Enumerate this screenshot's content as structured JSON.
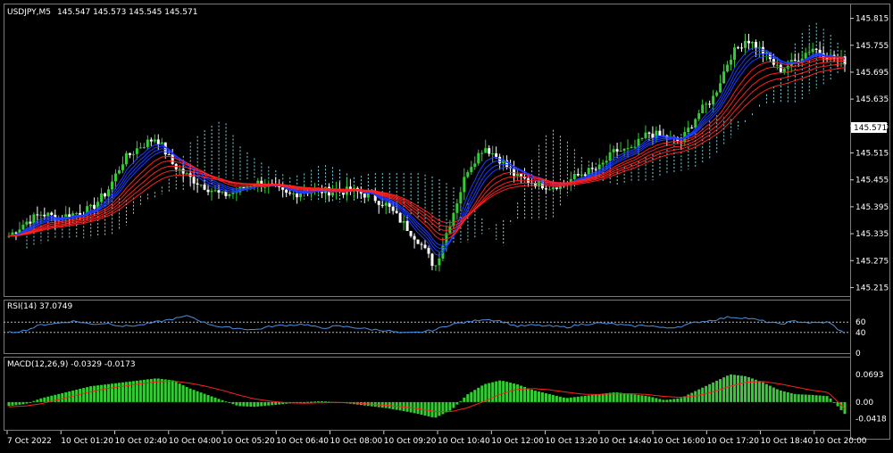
{
  "main": {
    "symbol": "USDJPY,M5",
    "ohlc": "145.547 145.573 145.545 145.571",
    "last_price": "145.571",
    "colors": {
      "bull": "#32cd32",
      "bear": "#ffffff",
      "fast_ma": "#1e3cff",
      "slow_ma": "#ff2020",
      "cloud": "#7fd3dc",
      "bg": "#000000",
      "grid": "#7a7a7a"
    }
  },
  "rsi": {
    "label": "RSI(14) 37.0749",
    "line_color": "#4a90e2",
    "levels": [
      60,
      40
    ]
  },
  "macd": {
    "label": "MACD(12,26,9) -0.0329 -0.0173",
    "hist_color": "#32cd32",
    "signal_color": "#ff2020"
  },
  "chart_data": [
    {
      "type": "line",
      "title": "USDJPY,M5",
      "ylim": [
        145.2,
        145.84
      ],
      "yticks": [
        "145.815",
        "145.755",
        "145.695",
        "145.635",
        "145.575",
        "145.515",
        "145.455",
        "145.395",
        "145.335",
        "145.275",
        "145.215"
      ],
      "xticks": [
        "7 Oct 2022",
        "10 Oct 01:20",
        "10 Oct 02:40",
        "10 Oct 04:00",
        "10 Oct 05:20",
        "10 Oct 06:40",
        "10 Oct 08:00",
        "10 Oct 09:20",
        "10 Oct 10:40",
        "10 Oct 12:00",
        "10 Oct 13:20",
        "10 Oct 14:40",
        "10 Oct 16:00",
        "10 Oct 17:20",
        "10 Oct 18:40",
        "10 Oct 20:00"
      ],
      "series": [
        {
          "values": [
            145.33,
            145.36,
            145.38,
            145.37,
            145.38,
            145.39,
            145.43,
            145.5,
            145.53,
            145.55,
            145.49,
            145.46,
            145.44,
            145.42,
            145.43,
            145.45,
            145.44,
            145.42,
            145.43,
            145.43,
            145.43,
            145.43,
            145.42,
            145.4,
            145.36,
            145.32,
            145.26,
            145.37,
            145.48,
            145.53,
            145.5,
            145.46,
            145.45,
            145.44,
            145.45,
            145.47,
            145.48,
            145.52,
            145.52,
            145.56,
            145.55,
            145.54,
            145.6,
            145.64,
            145.73,
            145.77,
            145.74,
            145.7,
            145.72,
            145.75,
            145.73,
            145.72
          ]
        }
      ]
    },
    {
      "type": "line",
      "title": "RSI(14) 37.0749",
      "ylim": [
        0,
        100
      ],
      "yticks": [
        "60",
        "40",
        "0"
      ],
      "series": [
        {
          "values": [
            40,
            44,
            55,
            58,
            62,
            56,
            58,
            52,
            54,
            60,
            66,
            72,
            58,
            50,
            48,
            45,
            52,
            54,
            56,
            48,
            52,
            50,
            46,
            44,
            38,
            40,
            45,
            56,
            60,
            66,
            62,
            52,
            54,
            52,
            50,
            56,
            58,
            56,
            52,
            54,
            48,
            52,
            60,
            64,
            70,
            68,
            62,
            56,
            62,
            58,
            60,
            37
          ]
        }
      ]
    },
    {
      "type": "bar",
      "title": "MACD(12,26,9) -0.0329 -0.0173",
      "ylim": [
        -0.07,
        0.11
      ],
      "yticks": [
        "0.0693",
        "0.00",
        "-0.0418"
      ],
      "series": [
        {
          "values": [
            -0.01,
            -0.005,
            0.01,
            0.02,
            0.03,
            0.04,
            0.045,
            0.05,
            0.055,
            0.06,
            0.055,
            0.035,
            0.02,
            0.005,
            -0.01,
            -0.012,
            -0.008,
            -0.004,
            0.0,
            0.002,
            0.0,
            -0.005,
            -0.01,
            -0.015,
            -0.022,
            -0.03,
            -0.04,
            -0.02,
            0.02,
            0.045,
            0.055,
            0.045,
            0.03,
            0.02,
            0.01,
            0.015,
            0.02,
            0.025,
            0.02,
            0.015,
            0.005,
            0.01,
            0.03,
            0.05,
            0.07,
            0.065,
            0.05,
            0.03,
            0.02,
            0.018,
            0.015,
            -0.03
          ]
        },
        {
          "values": [
            -0.012,
            -0.01,
            -0.004,
            0.006,
            0.016,
            0.026,
            0.034,
            0.04,
            0.046,
            0.051,
            0.053,
            0.048,
            0.04,
            0.03,
            0.018,
            0.008,
            0.002,
            -0.002,
            -0.003,
            -0.002,
            -0.001,
            -0.002,
            -0.005,
            -0.008,
            -0.012,
            -0.017,
            -0.024,
            -0.024,
            -0.014,
            0.002,
            0.02,
            0.032,
            0.034,
            0.031,
            0.025,
            0.02,
            0.019,
            0.021,
            0.021,
            0.019,
            0.014,
            0.012,
            0.016,
            0.026,
            0.04,
            0.05,
            0.052,
            0.046,
            0.038,
            0.03,
            0.024,
            -0.017
          ]
        }
      ]
    }
  ]
}
